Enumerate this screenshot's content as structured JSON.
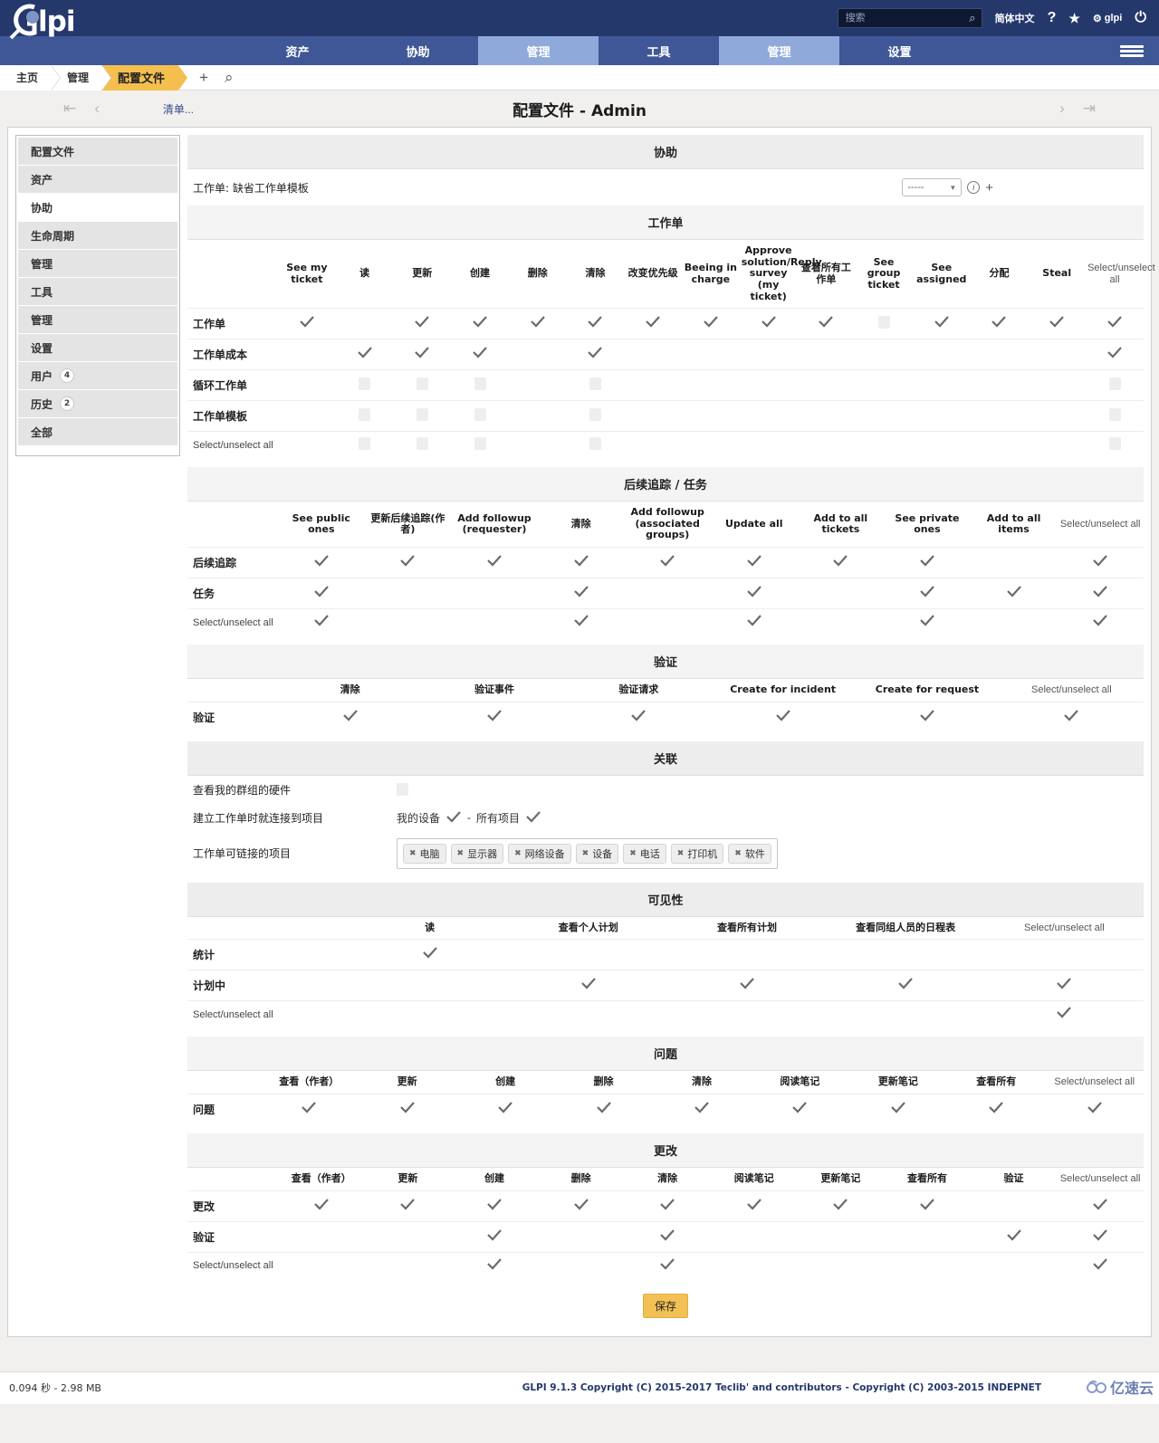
{
  "header": {
    "logo_text": "glpi",
    "search_placeholder": "搜索",
    "search_value": "",
    "language": "简体中文",
    "help_icon": "?",
    "star_icon": "★",
    "gear_user": "glpi",
    "power_icon": "⏻"
  },
  "mainnav": {
    "tabs": [
      {
        "label": "资产",
        "active": false
      },
      {
        "label": "协助",
        "active": false
      },
      {
        "label": "管理",
        "active": true
      },
      {
        "label": "工具",
        "active": false
      },
      {
        "label": "管理",
        "active": true
      },
      {
        "label": "设置",
        "active": false
      }
    ]
  },
  "breadcrumb": {
    "items": [
      {
        "label": "主页",
        "active": false
      },
      {
        "label": "管理",
        "active": false
      },
      {
        "label": "配置文件",
        "active": true
      }
    ],
    "add_icon": "+",
    "search_icon": "⌕"
  },
  "titlebar": {
    "first_icon": "❮❮",
    "prev_icon": "❮",
    "list_link": "清单...",
    "title": "配置文件 - Admin",
    "next_icon": "❯",
    "last_icon": "❯❯"
  },
  "sidebar": {
    "items": [
      {
        "label": "配置文件",
        "active": false,
        "badge": null
      },
      {
        "label": "资产",
        "active": false,
        "badge": null
      },
      {
        "label": "协助",
        "active": true,
        "badge": null
      },
      {
        "label": "生命周期",
        "active": false,
        "badge": null
      },
      {
        "label": "管理",
        "active": false,
        "badge": null
      },
      {
        "label": "工具",
        "active": false,
        "badge": null
      },
      {
        "label": "管理",
        "active": false,
        "badge": null
      },
      {
        "label": "设置",
        "active": false,
        "badge": null
      },
      {
        "label": "用户",
        "active": false,
        "badge": "4"
      },
      {
        "label": "历史",
        "active": false,
        "badge": "2"
      },
      {
        "label": "全部",
        "active": false,
        "badge": null
      }
    ]
  },
  "sections": {
    "assist_title": "协助",
    "template_row": {
      "label": "工作单: 缺省工作单模板",
      "select_value": "-----",
      "info_icon": "i",
      "plus_icon": "+"
    },
    "ticket": {
      "title": "工作单",
      "columns": [
        "See my ticket",
        "读",
        "更新",
        "创建",
        "删除",
        "清除",
        "改变优先级",
        "Beeing in charge",
        "Approve solution/Reply survey (my ticket)",
        "查看所有工作单",
        "See group ticket",
        "See assigned",
        "分配",
        "Steal",
        "Select/unselect all"
      ],
      "rows": [
        {
          "label": "工作单",
          "cells": [
            "check",
            "none",
            "check",
            "check",
            "check",
            "check",
            "check",
            "check",
            "check",
            "check",
            "box",
            "check",
            "check",
            "check",
            "check"
          ]
        },
        {
          "label": "工作单成本",
          "cells": [
            "none",
            "check",
            "check",
            "check",
            "none",
            "check",
            "none",
            "none",
            "none",
            "none",
            "none",
            "none",
            "none",
            "none",
            "check"
          ]
        },
        {
          "label": "循环工作单",
          "cells": [
            "none",
            "box",
            "box",
            "box",
            "none",
            "box",
            "none",
            "none",
            "none",
            "none",
            "none",
            "none",
            "none",
            "none",
            "box"
          ]
        },
        {
          "label": "工作单模板",
          "cells": [
            "none",
            "box",
            "box",
            "box",
            "none",
            "box",
            "none",
            "none",
            "none",
            "none",
            "none",
            "none",
            "none",
            "none",
            "box"
          ]
        },
        {
          "label": "Select/unselect all",
          "cells": [
            "none",
            "box",
            "box",
            "box",
            "none",
            "box",
            "none",
            "none",
            "none",
            "none",
            "none",
            "none",
            "none",
            "none",
            "box"
          ]
        }
      ]
    },
    "followup": {
      "title": "后续追踪 / 任务",
      "columns": [
        "See public ones",
        "更新后续追踪(作者)",
        "Add followup (requester)",
        "清除",
        "Add followup (associated groups)",
        "Update all",
        "Add to all tickets",
        "See private ones",
        "Add to all items",
        "Select/unselect all"
      ],
      "rows": [
        {
          "label": "后续追踪",
          "cells": [
            "check",
            "check",
            "check",
            "check",
            "check",
            "check",
            "check",
            "check",
            "none",
            "check"
          ]
        },
        {
          "label": "任务",
          "cells": [
            "check",
            "none",
            "none",
            "check",
            "none",
            "check",
            "none",
            "check",
            "check",
            "check"
          ]
        },
        {
          "label": "Select/unselect all",
          "cells": [
            "check",
            "none",
            "none",
            "check",
            "none",
            "check",
            "none",
            "check",
            "none",
            "check"
          ]
        }
      ]
    },
    "validation": {
      "title": "验证",
      "columns": [
        "清除",
        "验证事件",
        "验证请求",
        "Create for incident",
        "Create for request",
        "Select/unselect all"
      ],
      "rows": [
        {
          "label": "验证",
          "cells": [
            "check",
            "check",
            "check",
            "check",
            "check",
            "check"
          ]
        }
      ]
    },
    "association": {
      "title": "关联",
      "row1_label": "查看我的群组的硬件",
      "row1_state": "box",
      "row2_label": "建立工作单时就连接到项目",
      "row2_opt1": "我的设备",
      "row2_sep": "-",
      "row2_opt2": "所有项目",
      "row3_label": "工作单可链接的项目",
      "tags": [
        "电脑",
        "显示器",
        "网络设备",
        "设备",
        "电话",
        "打印机",
        "软件"
      ]
    },
    "visibility": {
      "title": "可见性",
      "columns": [
        "读",
        "查看个人计划",
        "查看所有计划",
        "查看同组人员的日程表",
        "Select/unselect all"
      ],
      "rows": [
        {
          "label": "统计",
          "cells": [
            "check",
            "none",
            "none",
            "none",
            "none"
          ]
        },
        {
          "label": "计划中",
          "cells": [
            "none",
            "check",
            "check",
            "check",
            "check"
          ]
        },
        {
          "label": "Select/unselect all",
          "cells": [
            "none",
            "none",
            "none",
            "none",
            "check"
          ]
        }
      ]
    },
    "problem": {
      "title": "问题",
      "columns": [
        "查看（作者）",
        "更新",
        "创建",
        "删除",
        "清除",
        "阅读笔记",
        "更新笔记",
        "查看所有",
        "Select/unselect all"
      ],
      "rows": [
        {
          "label": "问题",
          "cells": [
            "check",
            "check",
            "check",
            "check",
            "check",
            "check",
            "check",
            "check",
            "check"
          ]
        }
      ]
    },
    "change": {
      "title": "更改",
      "columns": [
        "查看（作者）",
        "更新",
        "创建",
        "删除",
        "清除",
        "阅读笔记",
        "更新笔记",
        "查看所有",
        "验证",
        "Select/unselect all"
      ],
      "rows": [
        {
          "label": "更改",
          "cells": [
            "check",
            "check",
            "check",
            "check",
            "check",
            "check",
            "check",
            "check",
            "none",
            "check"
          ]
        },
        {
          "label": "验证",
          "cells": [
            "none",
            "none",
            "check",
            "none",
            "check",
            "none",
            "none",
            "none",
            "check",
            "check"
          ]
        },
        {
          "label": "Select/unselect all",
          "cells": [
            "none",
            "none",
            "check",
            "none",
            "check",
            "none",
            "none",
            "none",
            "none",
            "check"
          ]
        }
      ]
    },
    "save_label": "保存"
  },
  "footer": {
    "left": "0.094 秒 - 2.98 MB",
    "right": "GLPI 9.1.3 Copyright (C) 2015-2017 Teclib' and contributors - Copyright (C) 2003-2015 INDEPNET",
    "watermark": "亿速云"
  }
}
